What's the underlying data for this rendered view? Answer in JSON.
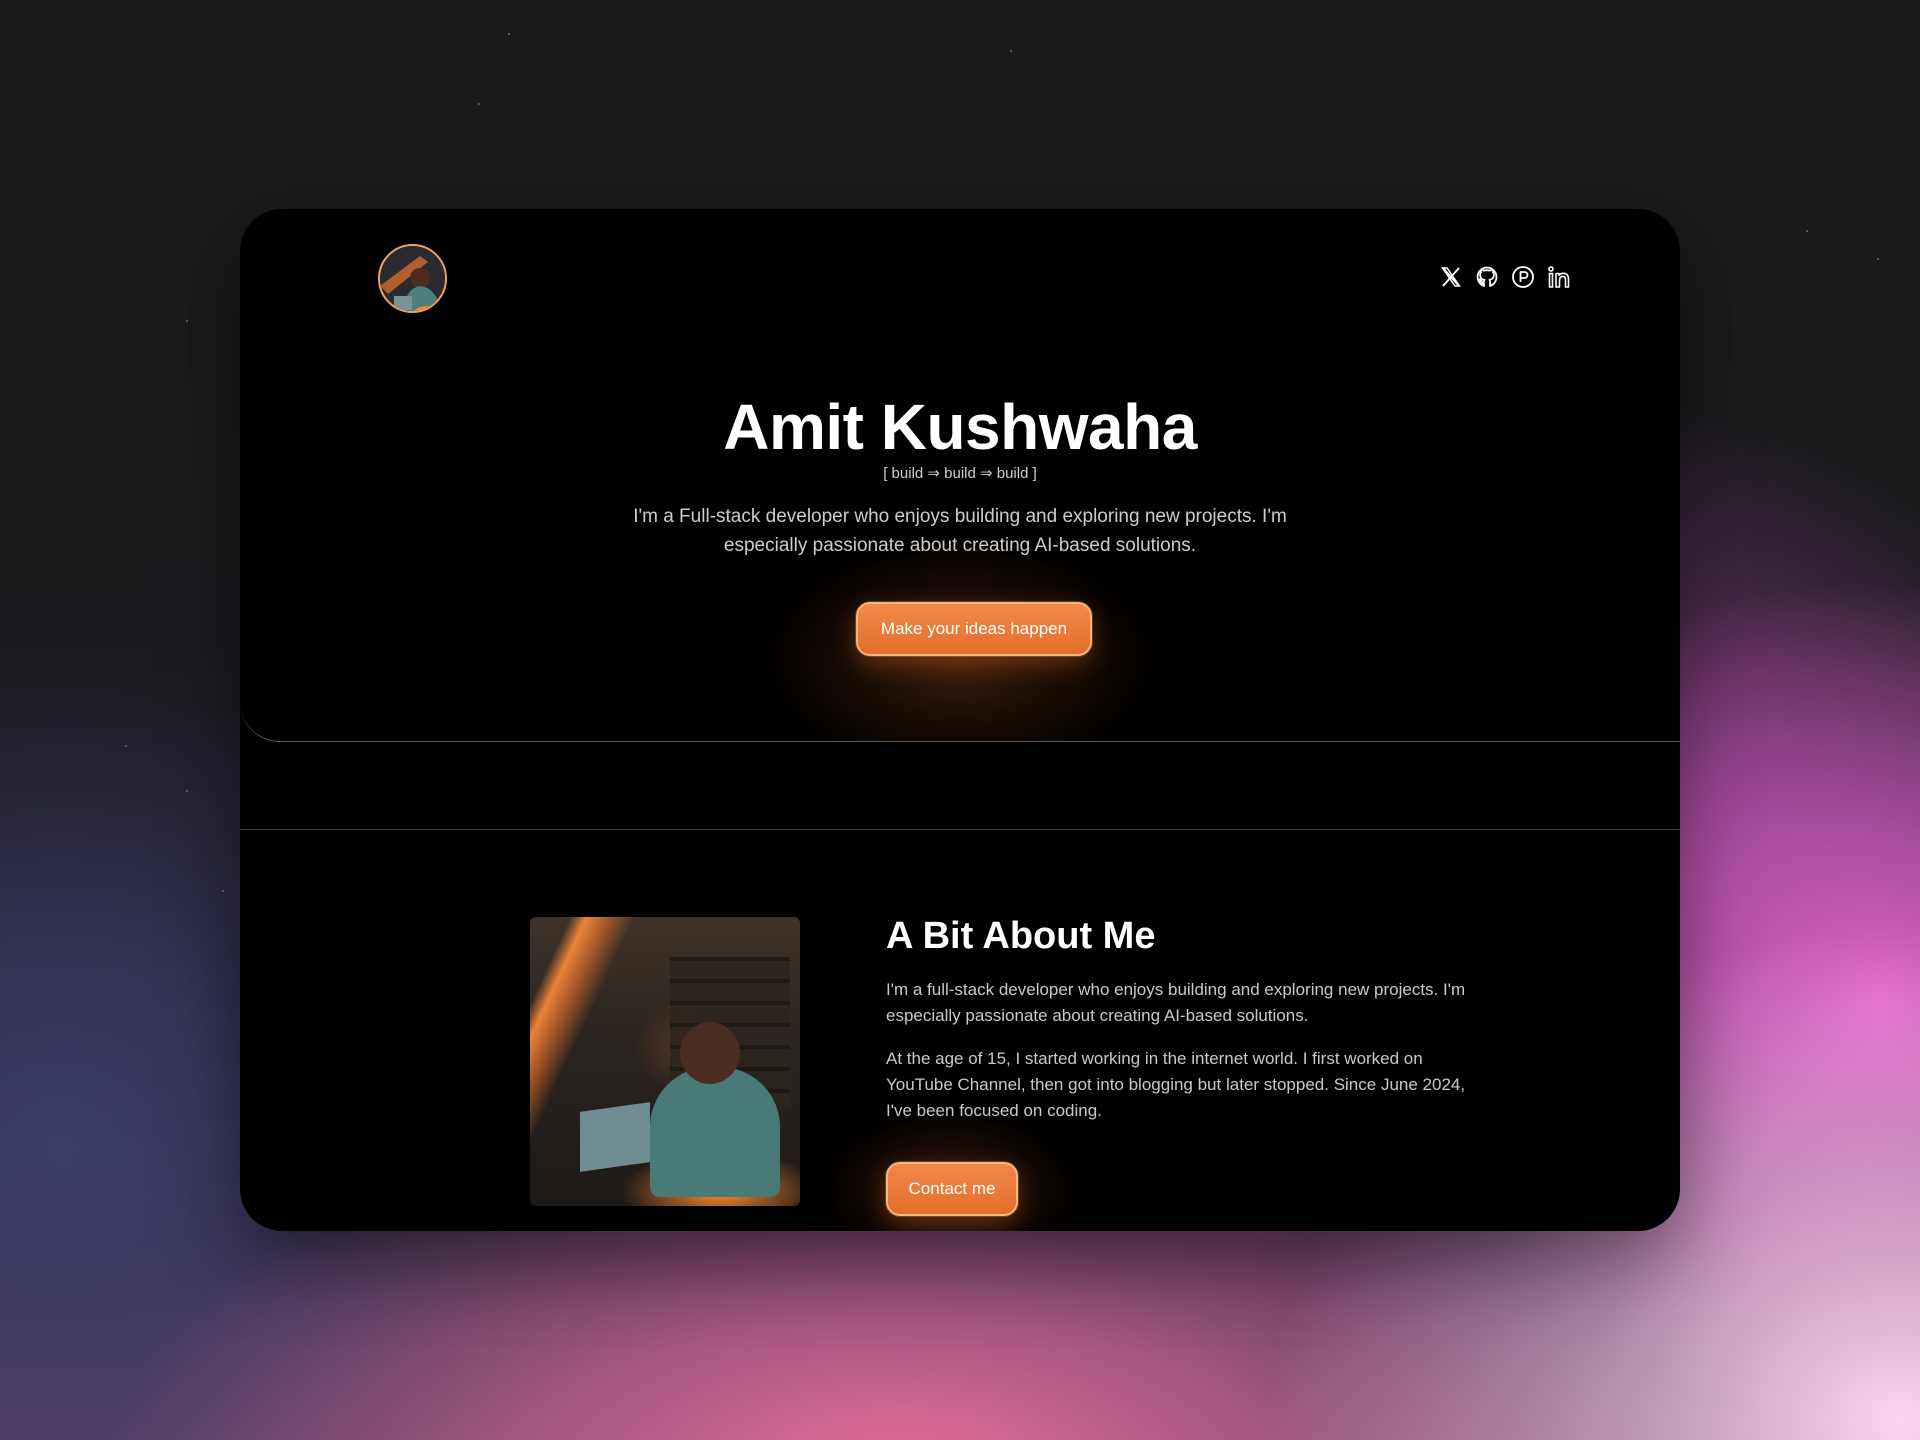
{
  "header": {
    "avatar_alt": "Amit Kushwaha avatar",
    "social": [
      {
        "name": "x-icon",
        "label": "X"
      },
      {
        "name": "github-icon",
        "label": "GitHub"
      },
      {
        "name": "producthunt-icon",
        "label": "Product Hunt"
      },
      {
        "name": "linkedin-icon",
        "label": "LinkedIn"
      }
    ]
  },
  "hero": {
    "title": "Amit Kushwaha",
    "tagline": "[ build ⇒ build ⇒ build ]",
    "description": "I'm a Full-stack developer who enjoys building and exploring new projects. I'm especially passionate about creating AI-based solutions.",
    "cta_label": "Make your ideas happen"
  },
  "about": {
    "title": "A Bit About Me",
    "paragraph1": "I'm a full-stack developer who enjoys building and exploring new projects. I'm especially passionate about creating AI-based solutions.",
    "paragraph2": "At the age of 15, I started working in the internet world. I first worked on YouTube Channel, then got into blogging but later stopped. Since June 2024, I've been focused on coding.",
    "cta_label": "Contact me"
  },
  "colors": {
    "accent": "#e8782f",
    "accent_border": "#f6b57e",
    "card_bg": "#000000"
  }
}
